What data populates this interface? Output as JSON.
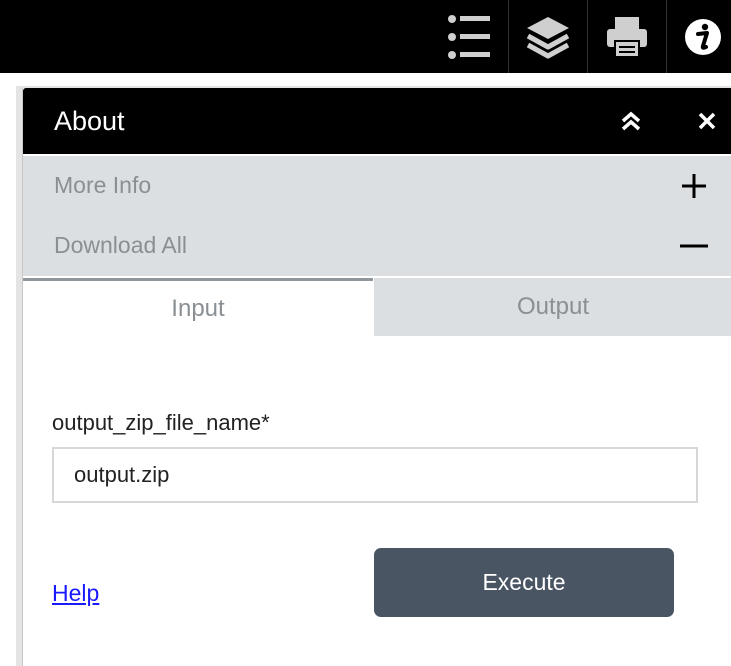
{
  "toolbar": {
    "icons": [
      "list-icon",
      "layers-icon",
      "print-icon",
      "info-icon"
    ]
  },
  "panel": {
    "title": "About",
    "accordion": [
      {
        "label": "More Info",
        "state": "collapsed"
      },
      {
        "label": "Download All",
        "state": "expanded"
      }
    ],
    "tabs": [
      {
        "label": "Input",
        "active": true
      },
      {
        "label": "Output",
        "active": false
      }
    ],
    "field": {
      "label": "output_zip_file_name*",
      "value": "output.zip"
    },
    "help_label": "Help",
    "execute_label": "Execute"
  },
  "colors": {
    "topbar": "#000000",
    "accordion_bg": "#dcdfe2",
    "execute_bg": "#4a5563",
    "link": "#1a1aff"
  }
}
